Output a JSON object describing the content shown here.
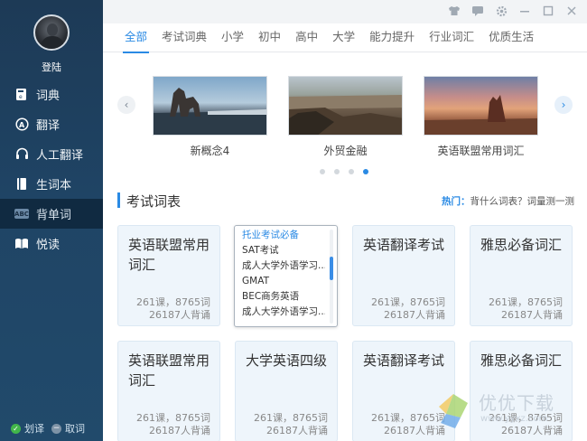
{
  "sidebar": {
    "login": "登陆",
    "items": [
      {
        "label": "词典",
        "icon": "dictionary-icon"
      },
      {
        "label": "翻译",
        "icon": "translate-icon"
      },
      {
        "label": "人工翻译",
        "icon": "headset-icon"
      },
      {
        "label": "生词本",
        "icon": "wordbook-icon"
      },
      {
        "label": "背单词",
        "icon": "abc-icon",
        "active": true
      },
      {
        "label": "悦读",
        "icon": "book-open-icon"
      }
    ],
    "bottom": {
      "word_translate": "划译",
      "word_fetch": "取词"
    }
  },
  "tabs": [
    "全部",
    "考试词典",
    "小学",
    "初中",
    "高中",
    "大学",
    "能力提升",
    "行业词汇",
    "优质生活"
  ],
  "carousel": {
    "slides": [
      {
        "caption": "新概念4"
      },
      {
        "caption": "外贸金融"
      },
      {
        "caption": "英语联盟常用词汇"
      }
    ],
    "active_dot": 3,
    "dot_count": 4
  },
  "section": {
    "title": "考试词表",
    "hot_label": "热门：",
    "hot_text": "背什么词表？词量测一测"
  },
  "cards": [
    {
      "name": "英语联盟常用词汇",
      "stat1": "261课，8765词",
      "stat2": "26187人背诵"
    },
    {
      "name": "英语翻译考试",
      "stat1": "261课，8765词",
      "stat2": "26187人背诵"
    },
    {
      "name": "雅思必备词汇",
      "stat1": "261课，8765词",
      "stat2": "26187人背诵"
    },
    {
      "name": "英语联盟常用词汇",
      "stat1": "261课，8765词",
      "stat2": "26187人背诵"
    },
    {
      "name": "大学英语四级",
      "stat1": "261课，8765词",
      "stat2": "26187人背诵"
    },
    {
      "name": "英语翻译考试",
      "stat1": "261课，8765词",
      "stat2": "26187人背诵"
    },
    {
      "name": "雅思必备词汇",
      "stat1": "261课，8765词",
      "stat2": "26187人背诵"
    }
  ],
  "dropdown": {
    "items": [
      "托业考试必备",
      "SAT考试",
      "成人大学外语学习...",
      "GMAT",
      "BEC商务英语",
      "成人大学外语学习..."
    ]
  },
  "watermark": {
    "text": "优优下载",
    "sub": "www.yyxz.com"
  },
  "colors": {
    "accent": "#2a8ae4",
    "sidebar": "#1f4465"
  }
}
